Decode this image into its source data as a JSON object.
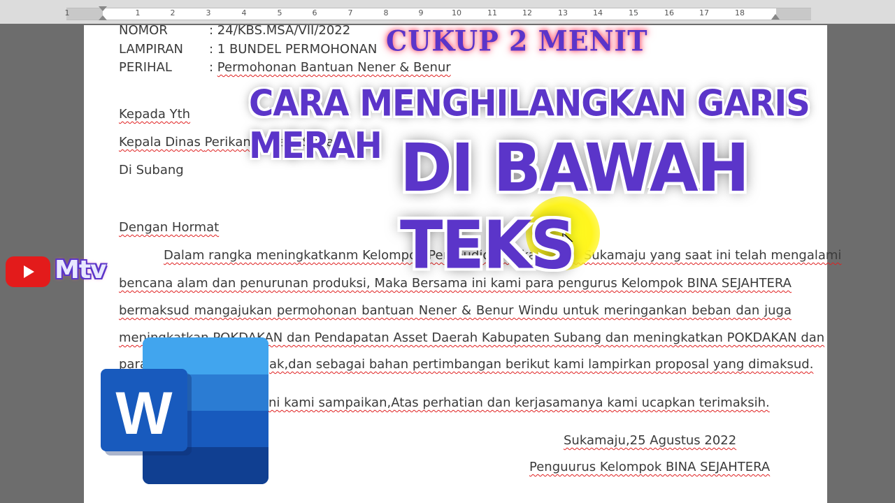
{
  "ruler": {
    "ticks": [
      "1",
      "1",
      "2",
      "3",
      "4",
      "5",
      "6",
      "7",
      "8",
      "9",
      "10",
      "11",
      "12",
      "13",
      "14",
      "15",
      "16",
      "17",
      "18"
    ]
  },
  "header_fields": [
    {
      "label": "NOMOR",
      "value": ": 24/KBS.MSA/VII/2022"
    },
    {
      "label": "LAMPIRAN",
      "value": ": 1 BUNDEL PERMOHONAN"
    },
    {
      "label": "PERIHAL",
      "value_prefix": ": ",
      "value": "Permohonan Bantuan Nener & Benur"
    }
  ],
  "recipient": {
    "line1": "Kepada Yth",
    "line2_pre": "Kepala Dinas ",
    "line2_sq": "Perikanan",
    "line2_post": " Kab. Subang",
    "line3": "Di Subang"
  },
  "greeting": "Dengan Hormat",
  "paragraph_lines": [
    "Dalam rangka meningkatkanm Kelompok Pembudidaya Ikan Desa Sukamaju yang saat ini telah mengalami",
    "bencana alam dan penurunan produksi, Maka Bersama ini kami para pengurus Kelompok BINA SEJAHTERA",
    "bermaksud mangajukan permohonan bantuan Nener & Benur Windu untuk meringankan beban dan juga",
    "meningkatkan POKDAKAN  dan Pendapatan Asset Daerah Kabupaten Subang dan meningkatkan POKDAKAN dan",
    "para",
    "ak,dan sebagai bahan pertimbangan berikut kami lampirkan proposal yang dimaksud."
  ],
  "closing_line": "ni kami sampaikan,Atas perhatian dan kerjasamanya kami ucapkan terimaksih.",
  "signature": {
    "place_date": "Sukamaju,25 Agustus 2022",
    "org": "Penguurus Kelompok BINA SEJAHTERA"
  },
  "overlay": {
    "small_title": "CUKUP 2 MENIT",
    "mid_title": "CARA MENGHILANGKAN GARIS MERAH",
    "big_title": "DI BAWAH TEKS",
    "channel": "Mtv",
    "accent_color": "#5b35c9",
    "youtube_color": "#e31b1b",
    "highlight_color": "#fff51e"
  },
  "icons": {
    "youtube": "youtube-play-icon",
    "word": "microsoft-word-icon",
    "cursor": "mouse-pointer-icon"
  }
}
